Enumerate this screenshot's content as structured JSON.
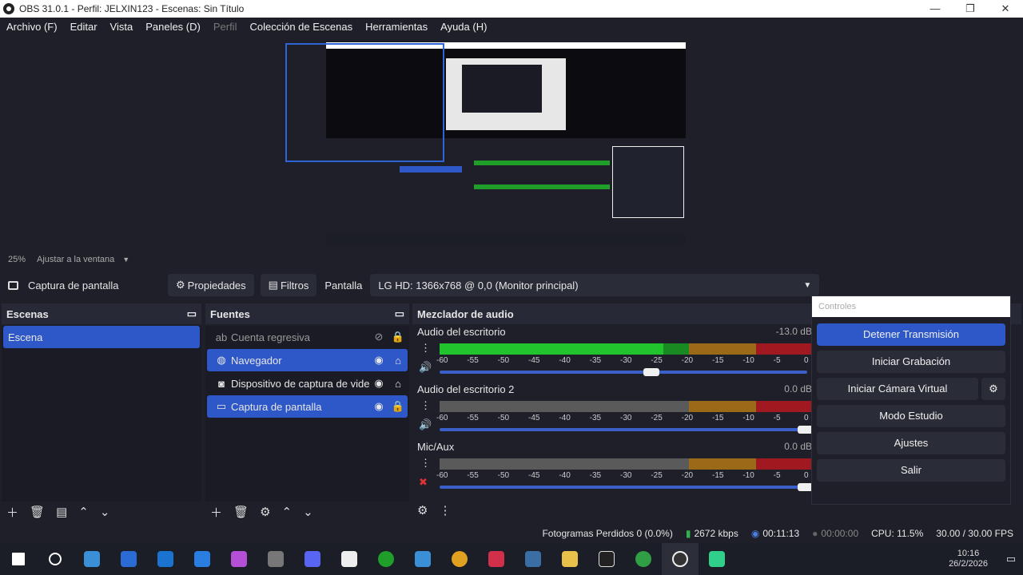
{
  "window": {
    "title": "OBS 31.0.1 - Perfil: JELXIN123 - Escenas: Sin Título",
    "min": "—",
    "max": "❐",
    "close": "✕"
  },
  "menu": [
    "Archivo (F)",
    "Editar",
    "Vista",
    "Paneles (D)",
    "Perfil",
    "Colección de Escenas",
    "Herramientas",
    "Ayuda (H)"
  ],
  "zoom": {
    "percent": "25%",
    "mode": "Ajustar a la ventana"
  },
  "source_toolbar": {
    "source": "Captura de pantalla",
    "properties": "Propiedades",
    "filters": "Filtros",
    "display_label": "Pantalla",
    "display_value": "LG HD: 1366x768 @ 0,0 (Monitor principal)"
  },
  "scenes": {
    "title": "Escenas",
    "items": [
      "Escena"
    ]
  },
  "sources": {
    "title": "Fuentes",
    "items": [
      {
        "name": "Cuenta regresiva",
        "icon": "text-icon",
        "visible": false,
        "locked": true
      },
      {
        "name": "Navegador",
        "icon": "globe-icon",
        "visible": true,
        "locked": false
      },
      {
        "name": "Dispositivo de captura de video",
        "icon": "camera-icon",
        "visible": true,
        "locked": false
      },
      {
        "name": "Captura de pantalla",
        "icon": "monitor-icon",
        "visible": true,
        "locked": true
      }
    ]
  },
  "mixer": {
    "title": "Mezclador de audio",
    "ticks": [
      "-60",
      "-55",
      "-50",
      "-45",
      "-40",
      "-35",
      "-30",
      "-25",
      "-20",
      "-15",
      "-10",
      "-5",
      "0"
    ],
    "channels": [
      {
        "name": "Audio del escritorio",
        "db": "-13.0 dB",
        "level": 0.6,
        "volume": 0.58
      },
      {
        "name": "Audio del escritorio 2",
        "db": "0.0 dB",
        "level": 0,
        "volume": 1.0
      },
      {
        "name": "Mic/Aux",
        "db": "0.0 dB",
        "level": 0,
        "volume": 1.0
      }
    ]
  },
  "controls": {
    "title": "Controles",
    "buttons": [
      "Detener Transmisión",
      "Iniciar Grabación",
      "Iniciar Cámara Virtual",
      "Modo Estudio",
      "Ajustes",
      "Salir"
    ]
  },
  "status": {
    "dropped": "Fotogramas Perdidos 0 (0.0%)",
    "bitrate": "2672 kbps",
    "stream_time": "00:11:13",
    "rec_time": "00:00:00",
    "cpu": "CPU: 11.5%",
    "fps": "30.00 / 30.00 FPS"
  },
  "taskbar": {
    "time": "10:16",
    "date": "26/2/2026"
  }
}
